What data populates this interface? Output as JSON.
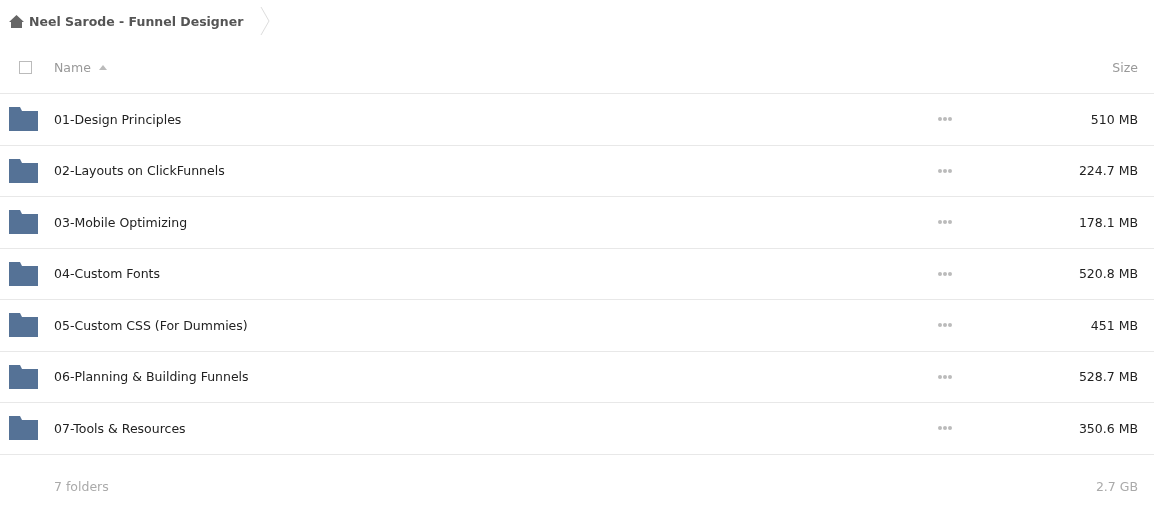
{
  "breadcrumb": {
    "title": "Neel Sarode - Funnel Designer"
  },
  "table": {
    "select_all": {
      "checked": false
    },
    "columns": [
      {
        "label": "Name",
        "sorted": true
      },
      {
        "label": "Size"
      }
    ],
    "rows": [
      {
        "name": "01-Design Principles",
        "size": "510 MB"
      },
      {
        "name": "02-Layouts on ClickFunnels",
        "size": "224.7 MB"
      },
      {
        "name": "03-Mobile Optimizing",
        "size": "178.1 MB"
      },
      {
        "name": "04-Custom Fonts",
        "size": "520.8 MB"
      },
      {
        "name": "05-Custom CSS (For Dummies)",
        "size": "451 MB"
      },
      {
        "name": "06-Planning & Building Funnels",
        "size": "528.7 MB"
      },
      {
        "name": "07-Tools & Resources",
        "size": "350.6 MB"
      }
    ]
  },
  "footer": {
    "count": "7 folders",
    "total": "2.7 GB"
  }
}
